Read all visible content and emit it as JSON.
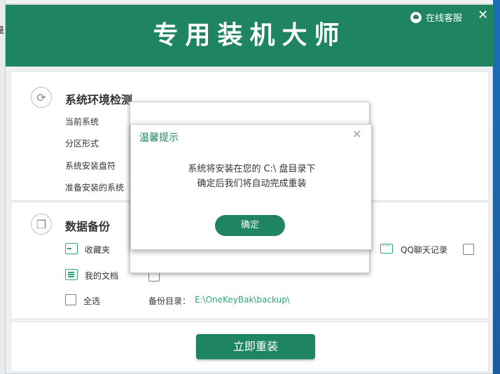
{
  "background": {
    "left_strip_char": "量"
  },
  "header": {
    "title": "专用装机大师",
    "service_label": "在线客服",
    "close_label": "✕"
  },
  "detect": {
    "title": "系统环境检测",
    "icon": "refresh-icon",
    "rows": [
      {
        "label": "当前系统"
      },
      {
        "label": "分区形式"
      },
      {
        "label": "系统安装盘符"
      },
      {
        "label": "准备安装的系统"
      }
    ]
  },
  "backup": {
    "title": "数据备份",
    "icon": "copy-icon",
    "items": [
      {
        "label": "收藏夹",
        "icon": "folder-icon"
      },
      {
        "label": "我的文档",
        "icon": "document-icon"
      },
      {
        "label": "QQ聊天记录",
        "icon": "chat-icon"
      }
    ],
    "select_all": "全选",
    "dir_label": "备份目录：",
    "dir_path": "E:\\OneKeyBak\\backup\\"
  },
  "footer": {
    "reinstall_button": "立即重装"
  },
  "modal": {
    "title": "温馨提示",
    "close": "✕",
    "line1": "系统将安装在您的 C:\\ 盘目录下",
    "line2": "确定后我们将自动完成重装",
    "ok_button": "确定"
  },
  "colors": {
    "brand_green": "#1e8462",
    "link_green": "#2aa876"
  }
}
